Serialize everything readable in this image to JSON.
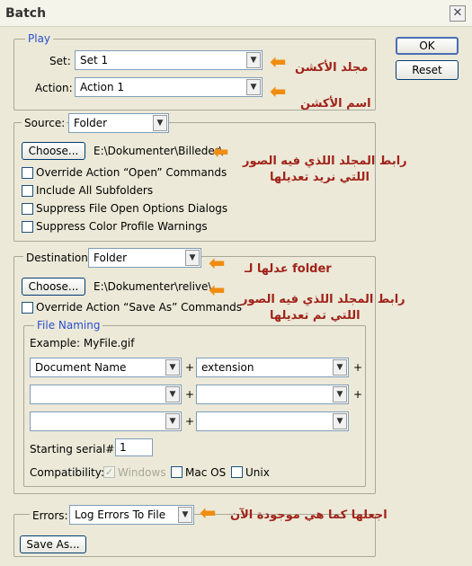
{
  "window": {
    "title": "Batch"
  },
  "buttons": {
    "ok": "OK",
    "reset": "Reset",
    "choose_source": "Choose...",
    "choose_dest": "Choose...",
    "save_as": "Save As..."
  },
  "play": {
    "legend": "Play",
    "set_label": "Set:",
    "set_value": "Set 1",
    "action_label": "Action:",
    "action_value": "Action 1"
  },
  "source": {
    "label": "Source:",
    "value": "Folder",
    "path": "E:\\Dokumenter\\Billeder\\",
    "options": [
      {
        "label": "Override Action “Open” Commands",
        "checked": false
      },
      {
        "label": "Include All Subfolders",
        "checked": false
      },
      {
        "label": "Suppress File Open Options Dialogs",
        "checked": false
      },
      {
        "label": "Suppress Color Profile Warnings",
        "checked": false
      }
    ]
  },
  "destination": {
    "label": "Destination:",
    "value": "Folder",
    "path": "E:\\Dokumenter\\relive\\",
    "override_label": "Override Action “Save As” Commands",
    "override_checked": false
  },
  "file_naming": {
    "legend": "File Naming",
    "example": "Example: MyFile.gif",
    "fields": [
      "Document Name",
      "extension",
      "",
      "",
      "",
      ""
    ],
    "plus": "+",
    "serial_label": "Starting serial#:",
    "serial_value": "1",
    "compat_label": "Compatibility:",
    "compat": [
      {
        "label": "Windows",
        "checked": true,
        "disabled": true
      },
      {
        "label": "Mac OS",
        "checked": false,
        "disabled": false
      },
      {
        "label": "Unix",
        "checked": false,
        "disabled": false
      }
    ]
  },
  "errors": {
    "label": "Errors:",
    "value": "Log Errors To File"
  },
  "annotations": {
    "set": "مجلد الأكشن",
    "action": "اسم الأكشن",
    "source_line1": "رابط المجلد اللذي فيه الصور",
    "source_line2": "اللتي نريد تعديلها",
    "dest": "عدلها لـ folder",
    "dest_path_line1": "رابط المجلد اللذي فيه الصور",
    "dest_path_line2": "اللتي تم تعديلها",
    "errors": "اجعلها كما هي موجودة الآن"
  },
  "icons": {
    "close": "close-icon",
    "dropdown": "chevron-down-icon",
    "arrow": "arrow-left-icon",
    "check": "checkmark-icon"
  }
}
